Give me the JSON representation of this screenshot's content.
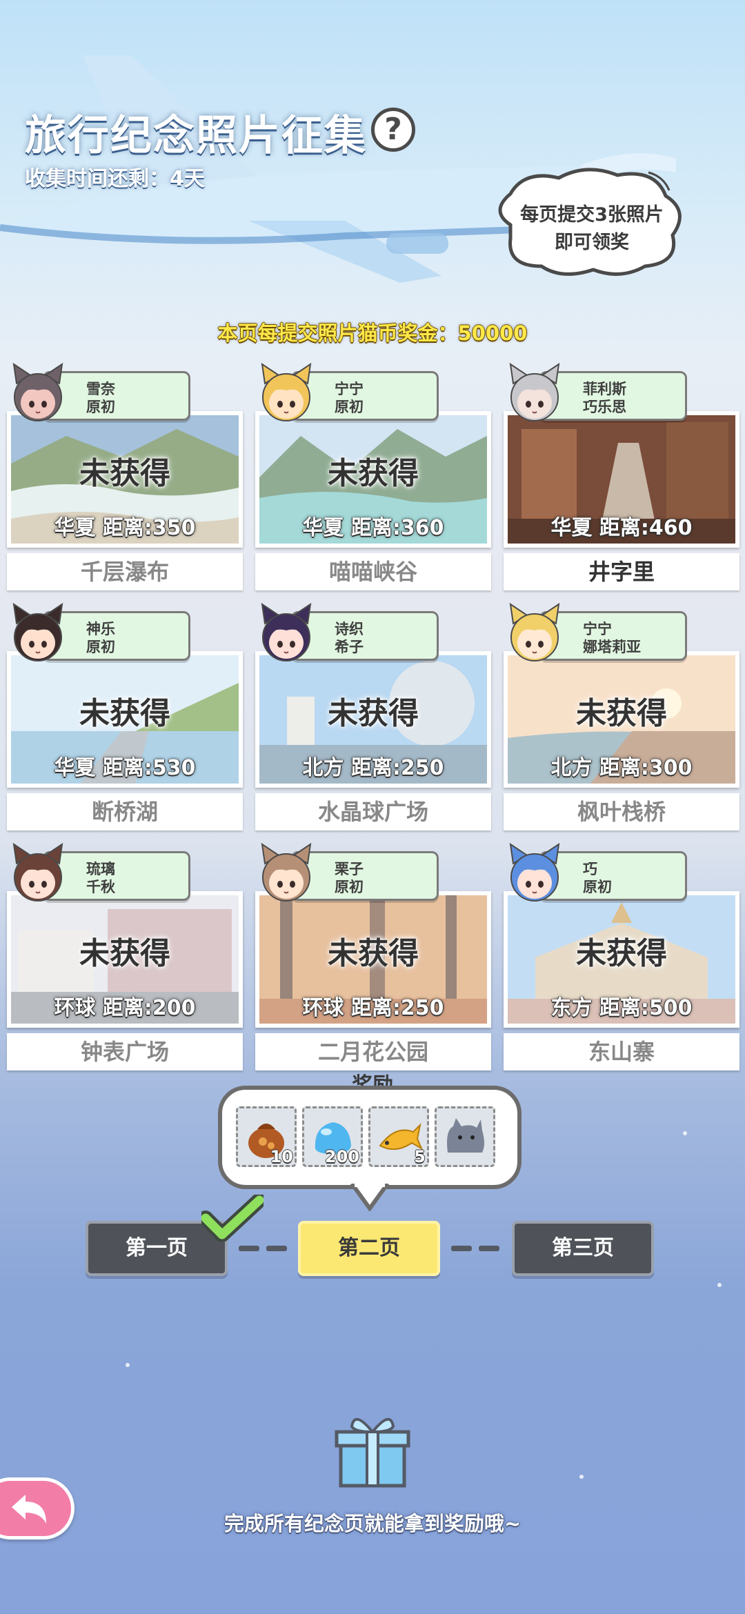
{
  "header": {
    "title": "旅行纪念照片征集",
    "help_label": "?",
    "timer": "收集时间还剩：4天",
    "bubble_line1": "每页提交3张照片",
    "bubble_line2": "即可领奖",
    "bonus": "本页每提交照片猫币奖金：50000"
  },
  "cards": [
    {
      "char1": "雪奈",
      "char2": "原初",
      "status": "未获得",
      "dist": "华夏  距离:350",
      "name": "千层瀑布",
      "obtained": false
    },
    {
      "char1": "宁宁",
      "char2": "原初",
      "status": "未获得",
      "dist": "华夏  距离:360",
      "name": "喵喵峡谷",
      "obtained": false
    },
    {
      "char1": "菲利斯",
      "char2": "巧乐思",
      "status": "",
      "dist": "华夏  距离:460",
      "name": "井字里",
      "obtained": true
    },
    {
      "char1": "神乐",
      "char2": "原初",
      "status": "未获得",
      "dist": "华夏  距离:530",
      "name": "断桥湖",
      "obtained": false
    },
    {
      "char1": "诗织",
      "char2": "希子",
      "status": "未获得",
      "dist": "北方  距离:250",
      "name": "水晶球广场",
      "obtained": false
    },
    {
      "char1": "宁宁",
      "char2": "娜塔莉亚",
      "status": "未获得",
      "dist": "北方  距离:300",
      "name": "枫叶栈桥",
      "obtained": false
    },
    {
      "char1": "琉璃",
      "char2": "千秋",
      "status": "未获得",
      "dist": "环球  距离:200",
      "name": "钟表广场",
      "obtained": false
    },
    {
      "char1": "栗子",
      "char2": "原初",
      "status": "未获得",
      "dist": "环球  距离:250",
      "name": "二月花公园",
      "obtained": false
    },
    {
      "char1": "巧",
      "char2": "原初",
      "status": "未获得",
      "dist": "东方  距离:500",
      "name": "东山寨",
      "obtained": false
    }
  ],
  "reward": {
    "title": "奖励",
    "items": [
      {
        "icon": "treasure-bag-icon",
        "count": "10"
      },
      {
        "icon": "blue-slime-icon",
        "count": "200"
      },
      {
        "icon": "fish-icon",
        "count": "5"
      },
      {
        "icon": "gray-cat-icon",
        "count": ""
      }
    ]
  },
  "pages": [
    {
      "label": "第一页",
      "state": "done"
    },
    {
      "label": "第二页",
      "state": "active"
    },
    {
      "label": "第三页",
      "state": "locked"
    }
  ],
  "footer": {
    "final_text": "完成所有纪念页就能拿到奖励哦~"
  }
}
